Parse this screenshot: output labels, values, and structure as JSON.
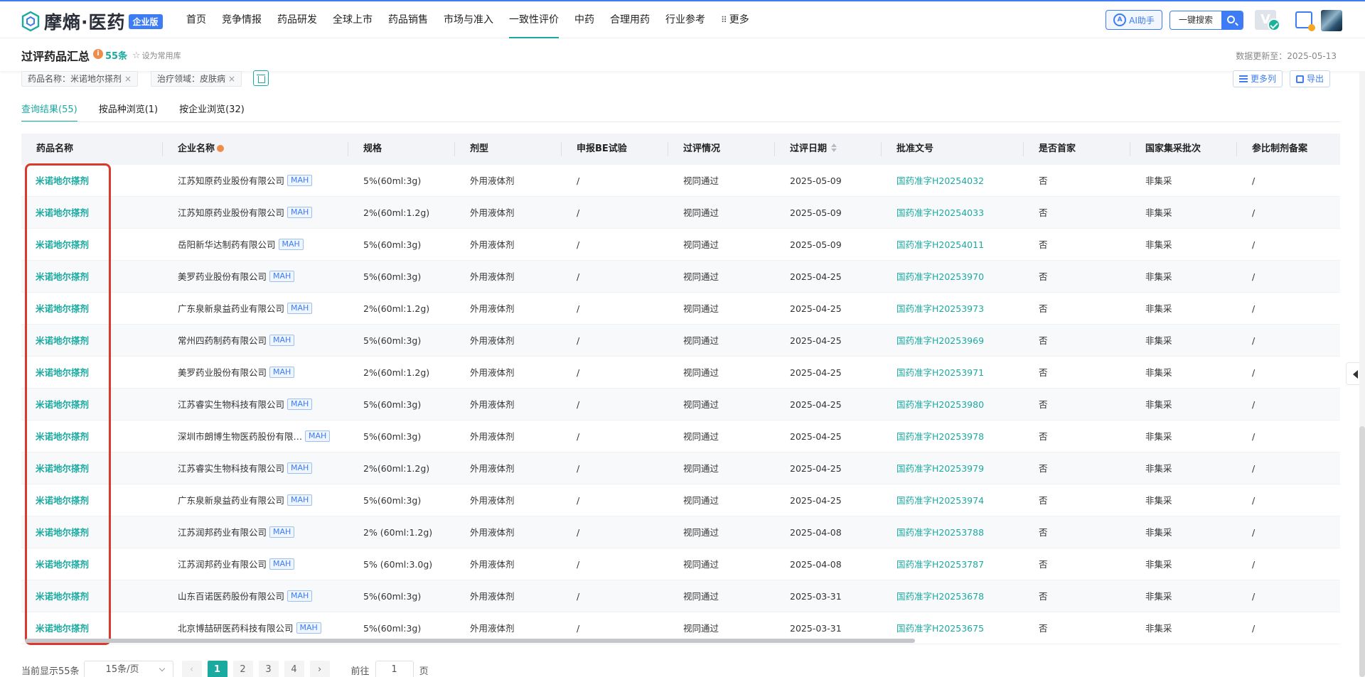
{
  "brand": {
    "name": "摩熵·医药",
    "badge": "企业版"
  },
  "nav": {
    "items": [
      "首页",
      "竞争情报",
      "药品研发",
      "全球上市",
      "药品销售",
      "市场与准入",
      "一致性评价",
      "中药",
      "合理用药",
      "行业参考",
      "更多"
    ],
    "active_index": 6
  },
  "toolbar": {
    "ai_label": "AI助手",
    "search_label": "一键搜索"
  },
  "page": {
    "title": "过评药品汇总",
    "count": "55条",
    "favorite": "设为常用库",
    "updated": "数据更新至：2025-05-13"
  },
  "filters": [
    {
      "label": "药品名称：米诺地尔搽剂"
    },
    {
      "label": "治疗领域：皮肤病"
    }
  ],
  "actions": {
    "more_columns": "更多列",
    "export": "导出"
  },
  "tabs": [
    "查询结果(55)",
    "按品种浏览(1)",
    "按企业浏览(32)"
  ],
  "table": {
    "headers": [
      "药品名称",
      "企业名称",
      "规格",
      "剂型",
      "申报BE试验",
      "过评情况",
      "过评日期",
      "批准文号",
      "是否首家",
      "国家集采批次",
      "参比制剂备案"
    ],
    "mah_tag": "MAH",
    "rows": [
      [
        "米诺地尔搽剂",
        "江苏知原药业股份有限公司",
        "5%(60ml:3g)",
        "外用液体剂",
        "/",
        "视同通过",
        "2025-05-09",
        "国药准字H20254032",
        "否",
        "非集采",
        "/"
      ],
      [
        "米诺地尔搽剂",
        "江苏知原药业股份有限公司",
        "2%(60ml:1.2g)",
        "外用液体剂",
        "/",
        "视同通过",
        "2025-05-09",
        "国药准字H20254033",
        "否",
        "非集采",
        "/"
      ],
      [
        "米诺地尔搽剂",
        "岳阳新华达制药有限公司",
        "5%(60ml:3g)",
        "外用液体剂",
        "/",
        "视同通过",
        "2025-05-09",
        "国药准字H20254011",
        "否",
        "非集采",
        "/"
      ],
      [
        "米诺地尔搽剂",
        "美罗药业股份有限公司",
        "5%(60ml:3g)",
        "外用液体剂",
        "/",
        "视同通过",
        "2025-04-25",
        "国药准字H20253970",
        "否",
        "非集采",
        "/"
      ],
      [
        "米诺地尔搽剂",
        "广东泉新泉益药业有限公司",
        "2%(60ml:1.2g)",
        "外用液体剂",
        "/",
        "视同通过",
        "2025-04-25",
        "国药准字H20253973",
        "否",
        "非集采",
        "/"
      ],
      [
        "米诺地尔搽剂",
        "常州四药制药有限公司",
        "5%(60ml:3g)",
        "外用液体剂",
        "/",
        "视同通过",
        "2025-04-25",
        "国药准字H20253969",
        "否",
        "非集采",
        "/"
      ],
      [
        "米诺地尔搽剂",
        "美罗药业股份有限公司",
        "2%(60ml:1.2g)",
        "外用液体剂",
        "/",
        "视同通过",
        "2025-04-25",
        "国药准字H20253971",
        "否",
        "非集采",
        "/"
      ],
      [
        "米诺地尔搽剂",
        "江苏睿实生物科技有限公司",
        "5%(60ml:3g)",
        "外用液体剂",
        "/",
        "视同通过",
        "2025-04-25",
        "国药准字H20253980",
        "否",
        "非集采",
        "/"
      ],
      [
        "米诺地尔搽剂",
        "深圳市朗博生物医药股份有限…",
        "5%(60ml:3g)",
        "外用液体剂",
        "/",
        "视同通过",
        "2025-04-25",
        "国药准字H20253978",
        "否",
        "非集采",
        "/"
      ],
      [
        "米诺地尔搽剂",
        "江苏睿实生物科技有限公司",
        "2%(60ml:1.2g)",
        "外用液体剂",
        "/",
        "视同通过",
        "2025-04-25",
        "国药准字H20253979",
        "否",
        "非集采",
        "/"
      ],
      [
        "米诺地尔搽剂",
        "广东泉新泉益药业有限公司",
        "5%(60ml:3g)",
        "外用液体剂",
        "/",
        "视同通过",
        "2025-04-25",
        "国药准字H20253974",
        "否",
        "非集采",
        "/"
      ],
      [
        "米诺地尔搽剂",
        "江苏润邦药业有限公司",
        "2% (60ml:1.2g)",
        "外用液体剂",
        "/",
        "视同通过",
        "2025-04-08",
        "国药准字H20253788",
        "否",
        "非集采",
        "/"
      ],
      [
        "米诺地尔搽剂",
        "江苏润邦药业有限公司",
        "5% (60ml:3.0g)",
        "外用液体剂",
        "/",
        "视同通过",
        "2025-04-08",
        "国药准字H20253787",
        "否",
        "非集采",
        "/"
      ],
      [
        "米诺地尔搽剂",
        "山东百诺医药股份有限公司",
        "5%(60ml:3g)",
        "外用液体剂",
        "/",
        "视同通过",
        "2025-03-31",
        "国药准字H20253678",
        "否",
        "非集采",
        "/"
      ],
      [
        "米诺地尔搽剂",
        "北京博喆研医药科技有限公司",
        "5%(60ml:3g)",
        "外用液体剂",
        "/",
        "视同通过",
        "2025-03-31",
        "国药准字H20253675",
        "否",
        "非集采",
        "/"
      ]
    ]
  },
  "pagination": {
    "showing": "当前显示55条",
    "page_size": "15条/页",
    "pages": [
      "1",
      "2",
      "3",
      "4"
    ],
    "current": "1",
    "goto_label": "前往",
    "goto_value": "1",
    "page_suffix": "页"
  },
  "colors": {
    "accent": "#1baaa0",
    "brand": "#3d7cf4",
    "highlight": "#d93a2b"
  }
}
